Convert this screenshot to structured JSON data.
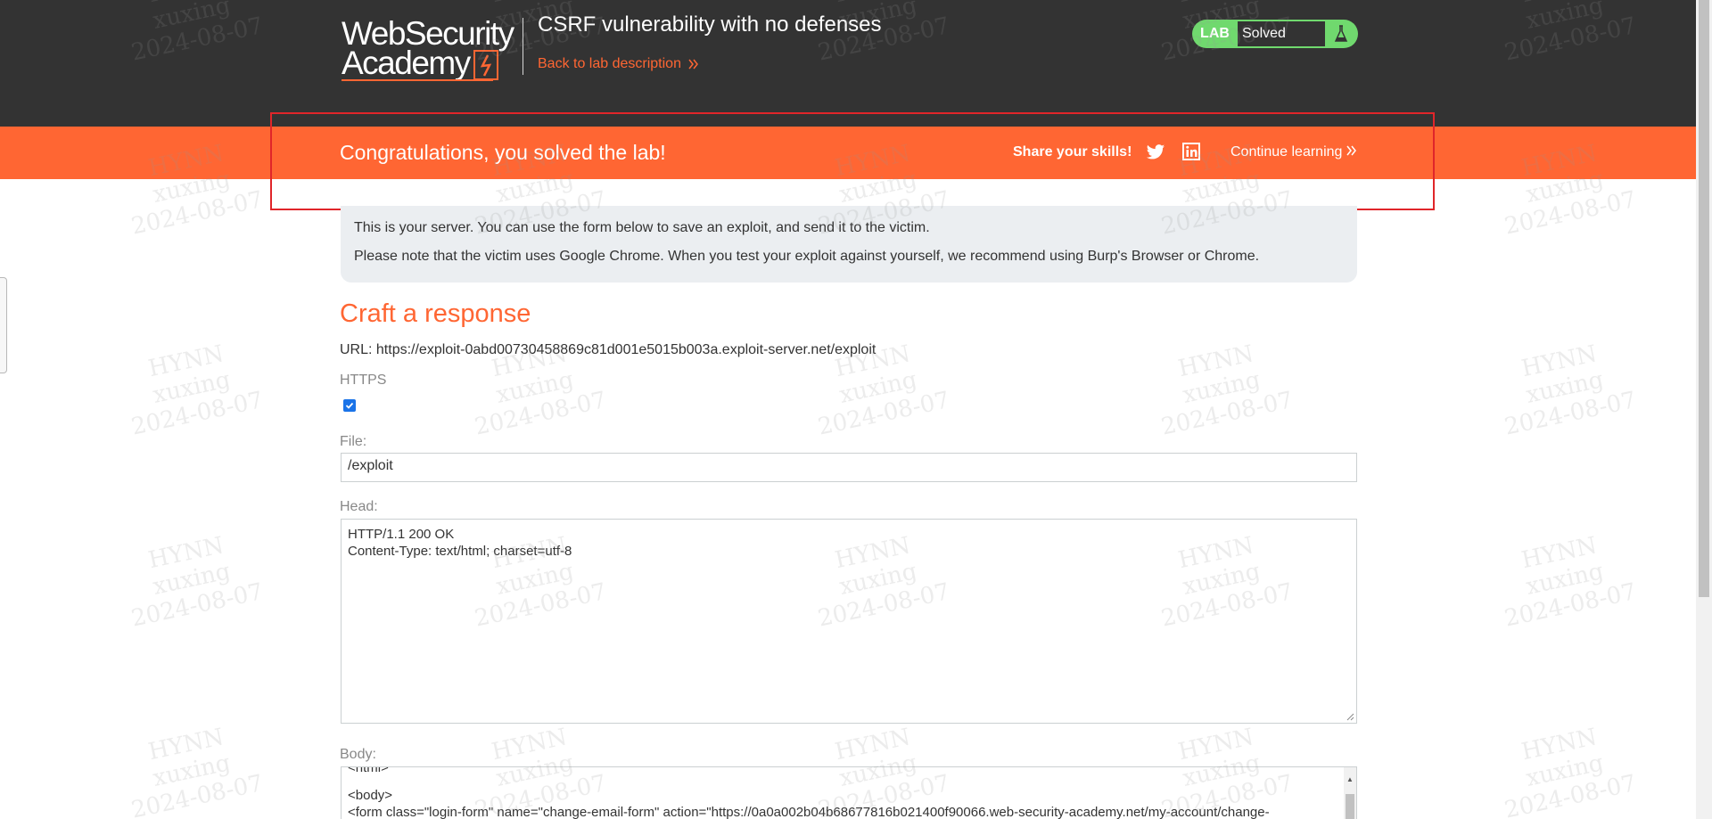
{
  "header": {
    "logo_line1": "WebSecurity",
    "logo_line2": "Academy",
    "lab_title": "CSRF vulnerability with no defenses",
    "back_link": "Back to lab description",
    "status": {
      "tag": "LAB",
      "value": "Solved",
      "accent": "#70d96e"
    }
  },
  "banner": {
    "message": "Congratulations, you solved the lab!",
    "share_label": "Share your skills!",
    "continue_label": "Continue learning",
    "color": "#ff6633"
  },
  "info": {
    "line1": "This is your server. You can use the form below to save an exploit, and send it to the victim.",
    "line2": "Please note that the victim uses Google Chrome. When you test your exploit against yourself, we recommend using Burp's Browser or Chrome."
  },
  "form": {
    "title": "Craft a response",
    "url_label": "URL: https://exploit-0abd00730458869c81d001e5015b003a.exploit-server.net/exploit",
    "https_label": "HTTPS",
    "https_checked": true,
    "file_label": "File:",
    "file_value": "/exploit",
    "head_label": "Head:",
    "head_line1": "HTTP/1.1 200 OK",
    "head_line2": "Content-Type: text/html; charset=utf-8",
    "body_label": "Body:",
    "body_line0": "<html>",
    "body_line1": "<body>",
    "body_line2": "<form class=\"login-form\" name=\"change-email-form\" action=\"https://0a0a002b04b68677816b021400f90066.web-security-academy.net/my-account/change-"
  },
  "watermark": {
    "line1": "HYNN",
    "line2": "xuxing",
    "line3": "2024-08-07"
  }
}
